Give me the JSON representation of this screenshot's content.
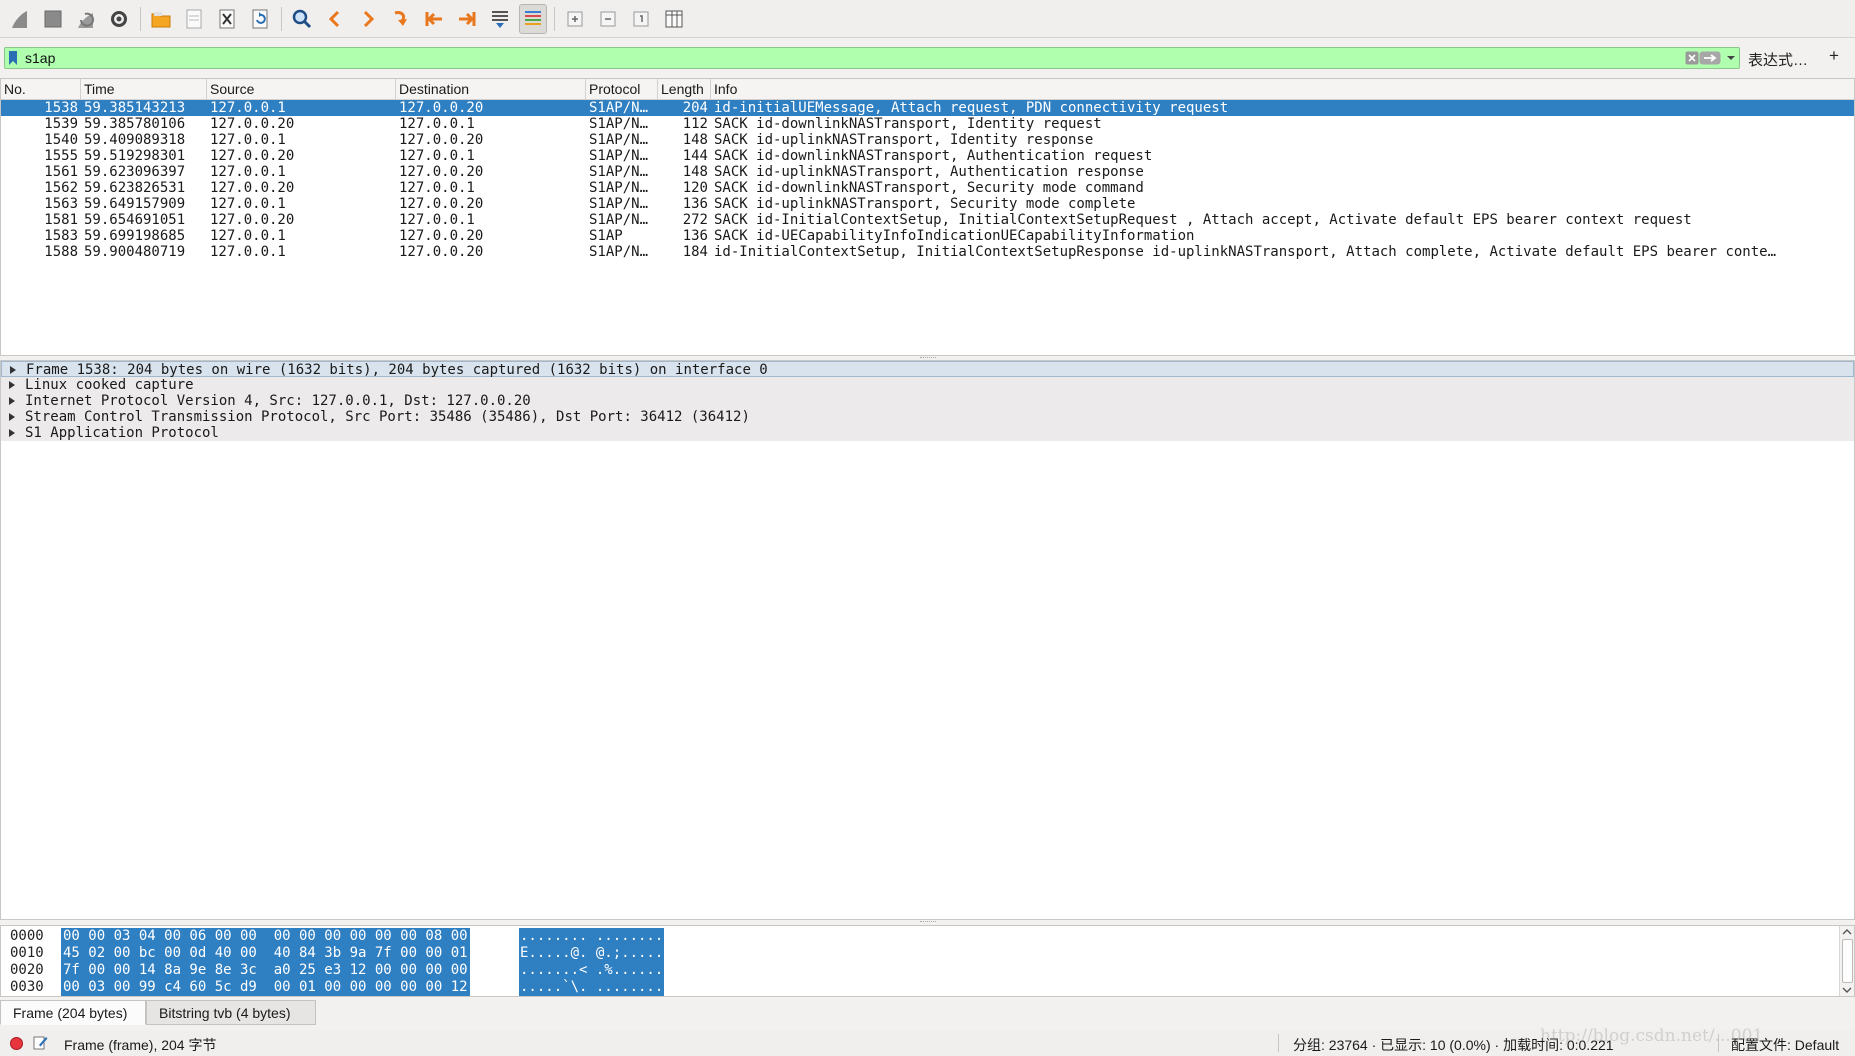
{
  "toolbar": {
    "buttons": [
      {
        "name": "start-capture-button",
        "icon": "shark-fin-icon"
      },
      {
        "name": "stop-capture-button",
        "icon": "stop-square-icon"
      },
      {
        "name": "restart-capture-button",
        "icon": "restart-fin-icon"
      },
      {
        "name": "capture-options-button",
        "icon": "gear-icon"
      },
      {
        "name": "open-file-button",
        "icon": "folder-icon"
      },
      {
        "name": "save-file-button",
        "icon": "file-icon"
      },
      {
        "name": "close-file-button",
        "icon": "close-file-icon"
      },
      {
        "name": "reload-file-button",
        "icon": "reload-icon"
      },
      {
        "name": "find-packet-button",
        "icon": "search-icon"
      },
      {
        "name": "go-back-button",
        "icon": "chevron-left-icon"
      },
      {
        "name": "go-forward-button",
        "icon": "chevron-right-icon"
      },
      {
        "name": "go-to-packet-button",
        "icon": "jump-arrow-icon"
      },
      {
        "name": "go-first-packet-button",
        "icon": "first-packet-icon"
      },
      {
        "name": "go-last-packet-button",
        "icon": "last-packet-icon"
      },
      {
        "name": "auto-scroll-button",
        "icon": "auto-scroll-icon"
      },
      {
        "name": "colorize-button",
        "icon": "colorize-lines-icon",
        "active": true
      },
      {
        "name": "zoom-in-button",
        "icon": "zoom-in-icon"
      },
      {
        "name": "zoom-out-button",
        "icon": "zoom-out-icon"
      },
      {
        "name": "normal-size-button",
        "icon": "normal-size-icon"
      },
      {
        "name": "resize-columns-button",
        "icon": "resize-columns-icon"
      }
    ]
  },
  "filter": {
    "value": "s1ap",
    "background_color": "#afffaf",
    "expression_label": "表达式…",
    "add_label": "+"
  },
  "packet_list": {
    "columns": [
      "No.",
      "Time",
      "Source",
      "Destination",
      "Protocol",
      "Length",
      "Info"
    ],
    "rows": [
      {
        "no": "1538",
        "time": "59.385143213",
        "src": "127.0.0.1",
        "dst": "127.0.0.20",
        "proto": "S1AP/N…",
        "len": "204",
        "info": "id-initialUEMessage, Attach request, PDN connectivity request",
        "selected": true
      },
      {
        "no": "1539",
        "time": "59.385780106",
        "src": "127.0.0.20",
        "dst": "127.0.0.1",
        "proto": "S1AP/N…",
        "len": "112",
        "info": "SACK id-downlinkNASTransport, Identity request",
        "marker": "•"
      },
      {
        "no": "1540",
        "time": "59.409089318",
        "src": "127.0.0.1",
        "dst": "127.0.0.20",
        "proto": "S1AP/N…",
        "len": "148",
        "info": "SACK id-uplinkNASTransport, Identity response"
      },
      {
        "no": "1555",
        "time": "59.519298301",
        "src": "127.0.0.20",
        "dst": "127.0.0.1",
        "proto": "S1AP/N…",
        "len": "144",
        "info": "SACK id-downlinkNASTransport, Authentication request"
      },
      {
        "no": "1561",
        "time": "59.623096397",
        "src": "127.0.0.1",
        "dst": "127.0.0.20",
        "proto": "S1AP/N…",
        "len": "148",
        "info": "SACK id-uplinkNASTransport, Authentication response"
      },
      {
        "no": "1562",
        "time": "59.623826531",
        "src": "127.0.0.20",
        "dst": "127.0.0.1",
        "proto": "S1AP/N…",
        "len": "120",
        "info": "SACK id-downlinkNASTransport, Security mode command"
      },
      {
        "no": "1563",
        "time": "59.649157909",
        "src": "127.0.0.1",
        "dst": "127.0.0.20",
        "proto": "S1AP/N…",
        "len": "136",
        "info": "SACK id-uplinkNASTransport, Security mode complete"
      },
      {
        "no": "1581",
        "time": "59.654691051",
        "src": "127.0.0.20",
        "dst": "127.0.0.1",
        "proto": "S1AP/N…",
        "len": "272",
        "info": "SACK id-InitialContextSetup, InitialContextSetupRequest , Attach accept, Activate default EPS bearer context request"
      },
      {
        "no": "1583",
        "time": "59.699198685",
        "src": "127.0.0.1",
        "dst": "127.0.0.20",
        "proto": "S1AP",
        "len": "136",
        "info": "SACK id-UECapabilityInfoIndicationUECapabilityInformation"
      },
      {
        "no": "1588",
        "time": "59.900480719",
        "src": "127.0.0.1",
        "dst": "127.0.0.20",
        "proto": "S1AP/N…",
        "len": "184",
        "info": "id-InitialContextSetup, InitialContextSetupResponse id-uplinkNASTransport, Attach complete, Activate default EPS bearer conte…"
      }
    ]
  },
  "details": [
    {
      "text": "Frame 1538: 204 bytes on wire (1632 bits), 204 bytes captured (1632 bits) on interface 0",
      "selected": true
    },
    {
      "text": "Linux cooked capture"
    },
    {
      "text": "Internet Protocol Version 4, Src: 127.0.0.1, Dst: 127.0.0.20"
    },
    {
      "text": "Stream Control Transmission Protocol, Src Port: 35486 (35486), Dst Port: 36412 (36412)"
    },
    {
      "text": "S1 Application Protocol"
    }
  ],
  "bytes": [
    {
      "offset": "0000",
      "hex": "00 00 03 04 00 06 00 00  00 00 00 00 00 00 08 00",
      "ascii": "........ ........"
    },
    {
      "offset": "0010",
      "hex": "45 02 00 bc 00 0d 40 00  40 84 3b 9a 7f 00 00 01",
      "ascii": "E.....@. @.;....."
    },
    {
      "offset": "0020",
      "hex": "7f 00 00 14 8a 9e 8e 3c  a0 25 e3 12 00 00 00 00",
      "ascii": ".......< .%......"
    },
    {
      "offset": "0030",
      "hex": "00 03 00 99 c4 60 5c d9  00 01 00 00 00 00 00 12",
      "ascii": ".....`\\. ........"
    }
  ],
  "bytes_tabs": [
    "Frame (204 bytes)",
    "Bitstring tvb (4 bytes)"
  ],
  "status": {
    "text": "Frame (frame), 204 字节",
    "stats": "分组: 23764 · 已显示: 10 (0.0%) · 加载时间: 0:0.221",
    "profile": "配置文件: Default",
    "watermark": "http://blog.csdn.net/...001"
  },
  "colors": {
    "selection": "#2f7fc3",
    "filter_valid": "#afffaf",
    "expert_error": "#e8343d"
  }
}
